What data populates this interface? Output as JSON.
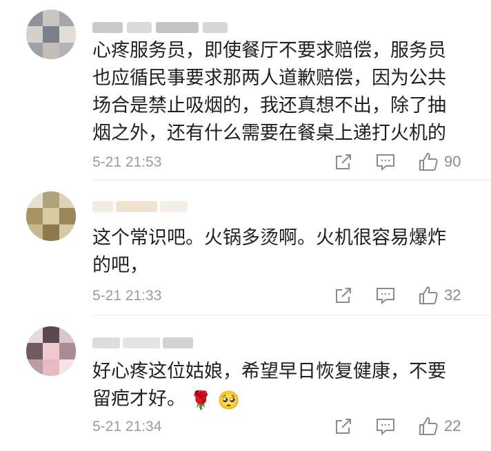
{
  "comments": [
    {
      "text": "心疼服务员，即使餐厅不要求赔偿，服务员\n也应循民事要求那两人道歉赔偿，因为公共\n场合是禁止吸烟的，我还真想不出，除了抽\n烟之外，还有什么需要在餐桌上递打火机的",
      "emoji": "",
      "time": "5-21 21:53",
      "likes": "90",
      "avatar_icon": "pixelated-avatar",
      "username_icon": "pixelated-username"
    },
    {
      "text": "这个常识吧。火锅多烫啊。火机很容易爆炸\n的吧，",
      "emoji": "",
      "time": "5-21 21:33",
      "likes": "32",
      "avatar_icon": "pixelated-avatar",
      "username_icon": "pixelated-username"
    },
    {
      "text": "好心疼这位姑娘，希望早日恢复健康，不要\n留疤才好。",
      "emoji": "🌹 🥺",
      "time": "5-21 21:34",
      "likes": "22",
      "avatar_icon": "pixelated-avatar",
      "username_icon": "pixelated-username"
    }
  ],
  "icons": {
    "share": "share-icon",
    "comment": "comment-icon",
    "like": "thumbs-up-icon"
  },
  "colors": {
    "text": "#1f1f1f",
    "meta": "#9a9a9a",
    "icon": "#8a8a8a"
  }
}
